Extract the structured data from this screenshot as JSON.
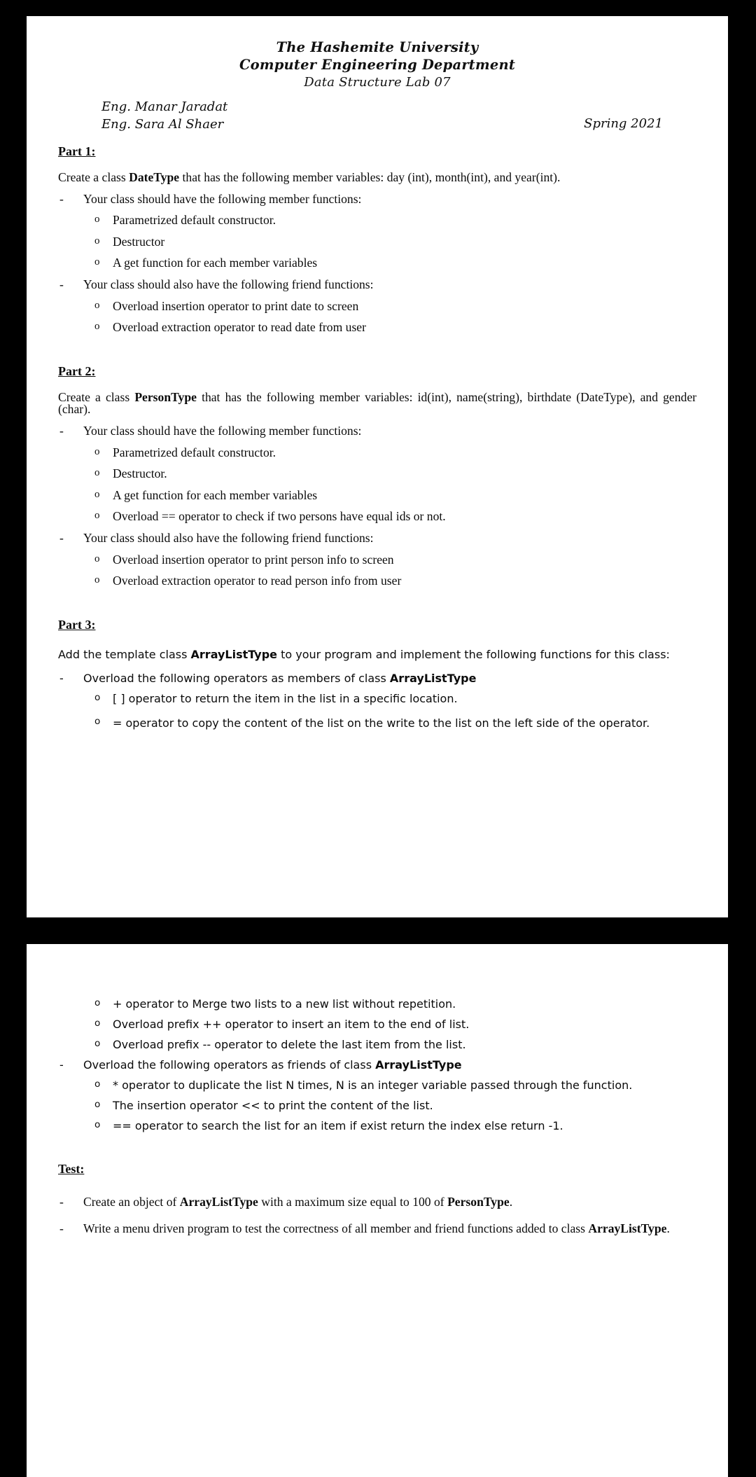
{
  "document": {
    "header": {
      "university": "The Hashemite University",
      "department": "Computer Engineering Department",
      "course": "Data Structure Lab 07",
      "instructor_1": "Eng. Manar Jaradat",
      "instructor_2": "Eng. Sara Al Shaer",
      "semester": "Spring 2021"
    },
    "part1": {
      "title": "Part 1:",
      "intro_pre": "Create a class ",
      "intro_bold": "DateType",
      "intro_post": " that has the following member variables:  day (int), month(int), and year(int).",
      "member_heading": "Your class should have the following member functions:",
      "member_items": [
        "Parametrized default constructor.",
        "Destructor",
        "A get function for each member  variables"
      ],
      "friend_heading": "Your class should also have the following friend functions:",
      "friend_items": [
        "Overload insertion operator to print date to screen",
        "Overload extraction operator to read date from user"
      ]
    },
    "part2": {
      "title": "Part 2:",
      "intro_pre": "Create a class ",
      "intro_bold": "PersonType",
      "intro_post": " that has the following member variables:  id(int),  name(string),  birthdate (DateType), and gender (char).",
      "member_heading": "Your class should have the following member functions:",
      "member_items": [
        "Parametrized default constructor.",
        "Destructor.",
        "A get function for each member  variables",
        "Overload == operator to check if two persons have equal ids or not."
      ],
      "friend_heading": "Your class should also have the following friend functions:",
      "friend_items": [
        "Overload insertion operator to print person info to screen",
        "Overload extraction operator to read person info from user"
      ]
    },
    "part3": {
      "title": "Part 3:",
      "intro_pre": "Add the template class ",
      "intro_bold": "ArrayListType",
      "intro_post": " to your program and implement the following functions for this class:",
      "members_heading_pre": "Overload the following operators as members of class ",
      "members_heading_bold": "ArrayListType",
      "member_items": [
        "[ ] operator to return the item in the list in a specific location.",
        "= operator to copy the content of the list on the write to the list on the left side of the operator.",
        "+ operator to Merge two lists to a new list without repetition.",
        "Overload prefix ++ operator to insert an item to the end of list.",
        "Overload prefix -- operator to delete the last item from the list."
      ],
      "friends_heading_pre": "Overload the following operators as friends of class ",
      "friends_heading_bold": "ArrayListType",
      "friend_items": [
        "* operator to duplicate the list N times, N is an integer variable passed through the function.",
        "The insertion operator << to print the content of the list.",
        "== operator to search the list for an item if exist return the index else return -1."
      ]
    },
    "test": {
      "title": "Test:",
      "item1_pre": "Create an object of ",
      "item1_bold1": "ArrayListType",
      "item1_mid": " with a maximum size equal to 100 of ",
      "item1_bold2": "PersonType",
      "item1_post": ".",
      "item2_pre": "Write a menu driven program to test the correctness of all member and friend functions added to class ",
      "item2_bold": "ArrayListType",
      "item2_post": "."
    },
    "symbols": {
      "dash": "-",
      "circle": "o"
    },
    "colors": {
      "background": "#000000",
      "page": "#ffffff",
      "text": "#0b0b0b"
    }
  }
}
